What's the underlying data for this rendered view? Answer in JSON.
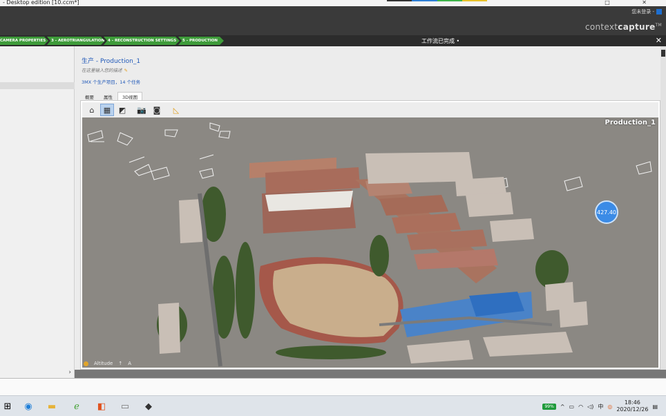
{
  "window": {
    "title": "- Desktop edition [10.ccm*]",
    "controls": "□ ✕",
    "title_stripe_colors": [
      "#333333",
      "#2d7fd6",
      "#3fb54a",
      "#e8c22a"
    ]
  },
  "header": {
    "user_text": "您未登录 -",
    "brand_light": "context",
    "brand_bold": "capture",
    "brand_tm": "TM"
  },
  "steps": [
    {
      "label": "CAMERA PROPERTIES"
    },
    {
      "label": "3 - AEROTRIANGULATION"
    },
    {
      "label": "4 - RECONSTRUCTION SETTINGS"
    },
    {
      "label": "5 - PRODUCTION"
    }
  ],
  "status_text": "工作流已完成 •",
  "close_glyph": "✕",
  "production": {
    "title": "生产 - Production_1",
    "description_placeholder": "在这里输入您的描述",
    "summary": "3MX 个生产项目，14 个任务"
  },
  "tabs": [
    {
      "label": "概要",
      "active": false
    },
    {
      "label": "属性",
      "active": false
    },
    {
      "label": "3D视图",
      "active": true
    }
  ],
  "toolbar_icons": [
    {
      "name": "home-icon",
      "glyph": "⌂",
      "active": false
    },
    {
      "name": "texture-mode-icon",
      "glyph": "▦",
      "active": true
    },
    {
      "name": "wireframe-mode-icon",
      "glyph": "◩",
      "active": false
    },
    {
      "name": "snapshot-icon",
      "glyph": "📷",
      "active": false
    },
    {
      "name": "camera-icon",
      "glyph": "◙",
      "active": false
    },
    {
      "name": "measure-icon",
      "glyph": "◺",
      "active": false
    }
  ],
  "viewport": {
    "label": "Production_1",
    "bubble_value": "427.40",
    "status_altitude": "Altitude",
    "status_a": "A"
  },
  "left_panel": {
    "collapse_glyph": "›"
  },
  "taskbar": {
    "battery": "99%",
    "ime": "中",
    "time": "18:46",
    "date": "2020/12/26"
  }
}
